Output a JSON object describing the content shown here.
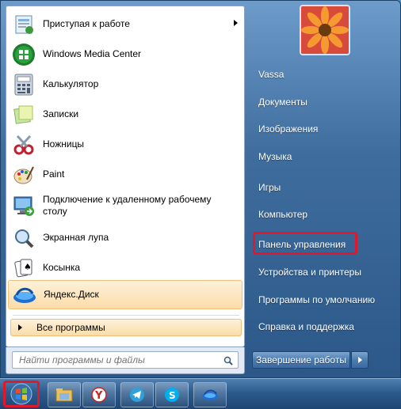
{
  "menu": {
    "pinned": [
      {
        "label": "Приступая к работе",
        "icon": "getting-started-icon",
        "submenu": true
      },
      {
        "label": "Windows Media Center",
        "icon": "windows-media-center-icon"
      },
      {
        "label": "Калькулятор",
        "icon": "calculator-icon"
      },
      {
        "label": "Записки",
        "icon": "sticky-notes-icon"
      },
      {
        "label": "Ножницы",
        "icon": "scissors-icon"
      },
      {
        "label": "Paint",
        "icon": "paint-palette-icon"
      },
      {
        "label": "Подключение к удаленному рабочему столу",
        "icon": "remote-desktop-icon"
      },
      {
        "label": "Экранная лупа",
        "icon": "magnifier-icon"
      },
      {
        "label": "Косынка",
        "icon": "solitaire-cards-icon"
      },
      {
        "label": "Яндекс.Диск",
        "icon": "yandex-disk-icon",
        "selected": true
      }
    ],
    "all_programs": "Все программы",
    "search_placeholder": "Найти программы и файлы"
  },
  "right": {
    "items": [
      "Vassa",
      "Документы",
      "Изображения",
      "Музыка",
      "Игры",
      "Компьютер",
      "Панель управления",
      "Устройства и принтеры",
      "Программы по умолчанию",
      "Справка и поддержка"
    ],
    "highlighted": "Панель управления",
    "shutdown": "Завершение работы"
  },
  "taskbar": {
    "buttons": [
      "file-explorer-icon",
      "yandex-browser-icon",
      "telegram-icon",
      "skype-icon",
      "yandex-disk-icon"
    ]
  },
  "colors": {
    "highlight_box": "#e0182c",
    "selection": "#fbdca8"
  }
}
